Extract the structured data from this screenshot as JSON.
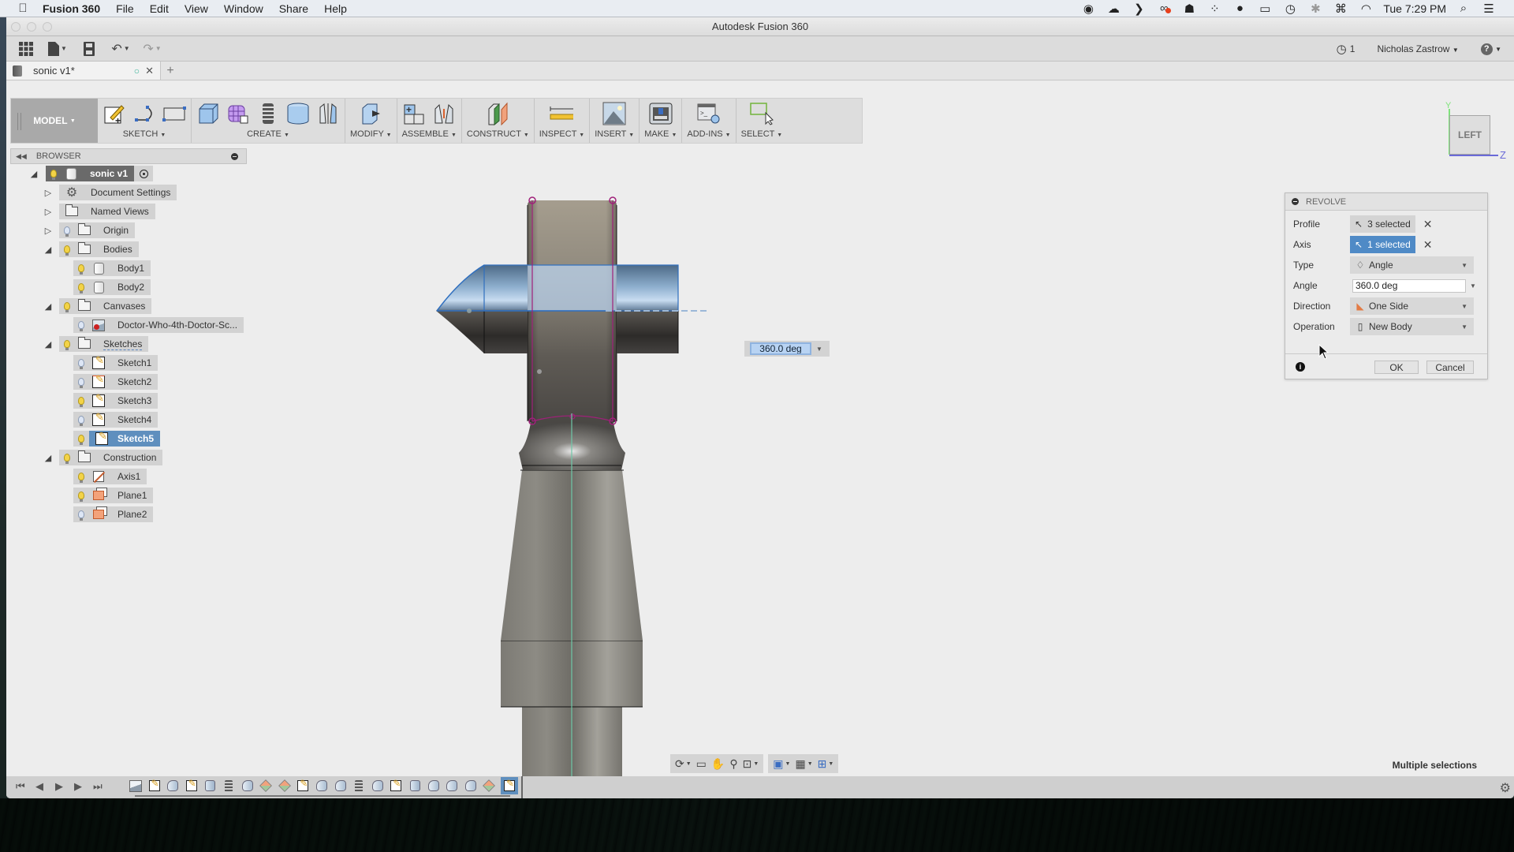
{
  "menubar": {
    "apple_icon": "apple-logo-icon",
    "app_name": "Fusion 360",
    "menus": [
      "File",
      "Edit",
      "View",
      "Window",
      "Share",
      "Help"
    ],
    "status_icons": [
      "record-icon",
      "cloud-upload-icon",
      "chevron-right-icon",
      "creative-cloud-icon",
      "ghost-icon",
      "grid-dots-icon",
      "chat-bubble-icon",
      "screens-icon",
      "time-machine-icon",
      "bluetooth-icon",
      "keyboard-icon",
      "wifi-icon"
    ],
    "clock": "Tue 7:29 PM",
    "search_icon": "spotlight-search-icon",
    "list_icon": "notification-center-icon"
  },
  "window": {
    "title": "Autodesk Fusion 360"
  },
  "quick_access": {
    "jobs_count": "1",
    "user_name": "Nicholas Zastrow",
    "help_icon": "help-icon"
  },
  "document_tab": {
    "name": "sonic v1*",
    "new_tab": "+"
  },
  "ribbon": {
    "workspace": "MODEL",
    "groups": [
      {
        "label": "SKETCH"
      },
      {
        "label": "CREATE"
      },
      {
        "label": "MODIFY"
      },
      {
        "label": "ASSEMBLE"
      },
      {
        "label": "CONSTRUCT"
      },
      {
        "label": "INSPECT"
      },
      {
        "label": "INSERT"
      },
      {
        "label": "MAKE"
      },
      {
        "label": "ADD-INS"
      },
      {
        "label": "SELECT"
      }
    ]
  },
  "browser": {
    "title": "BROWSER",
    "root": "sonic v1",
    "items": [
      {
        "label": "Document Settings"
      },
      {
        "label": "Named Views"
      },
      {
        "label": "Origin"
      },
      {
        "label": "Bodies"
      },
      {
        "label": "Body1"
      },
      {
        "label": "Body2"
      },
      {
        "label": "Canvases"
      },
      {
        "label": "Doctor-Who-4th-Doctor-Sc..."
      },
      {
        "label": "Sketches"
      },
      {
        "label": "Sketch1"
      },
      {
        "label": "Sketch2"
      },
      {
        "label": "Sketch3"
      },
      {
        "label": "Sketch4"
      },
      {
        "label": "Sketch5"
      },
      {
        "label": "Construction"
      },
      {
        "label": "Axis1"
      },
      {
        "label": "Plane1"
      },
      {
        "label": "Plane2"
      }
    ]
  },
  "viewcube": {
    "face": "LEFT",
    "y_axis": "Y",
    "z_axis": "Z"
  },
  "angle_input": {
    "value": "360.0 deg"
  },
  "revolve_dialog": {
    "title": "REVOLVE",
    "profile_label": "Profile",
    "profile_value": "3 selected",
    "axis_label": "Axis",
    "axis_value": "1 selected",
    "type_label": "Type",
    "type_value": "Angle",
    "angle_label": "Angle",
    "angle_value": "360.0 deg",
    "direction_label": "Direction",
    "direction_value": "One Side",
    "operation_label": "Operation",
    "operation_value": "New Body",
    "ok": "OK",
    "cancel": "Cancel"
  },
  "status": {
    "message": "Multiple selections"
  },
  "colors": {
    "selection_blue": "#4f8ac6",
    "sketch_profile": "#a0207a",
    "axis_green": "#7ee37a",
    "axis_blue": "#6a6ad8"
  }
}
